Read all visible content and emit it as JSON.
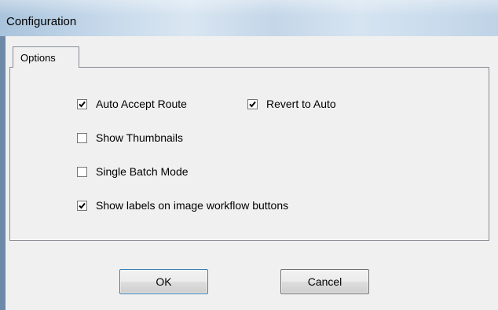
{
  "window": {
    "title": "Configuration"
  },
  "tabs": [
    {
      "label": "Options",
      "selected": true
    }
  ],
  "options": {
    "auto_accept_route": {
      "label": "Auto Accept Route",
      "checked": true
    },
    "revert_to_auto": {
      "label": "Revert to Auto",
      "checked": true
    },
    "show_thumbnails": {
      "label": "Show Thumbnails",
      "checked": false
    },
    "single_batch_mode": {
      "label": "Single Batch Mode",
      "checked": false
    },
    "show_labels": {
      "label": "Show labels on image workflow buttons",
      "checked": true
    }
  },
  "buttons": {
    "ok_label": "OK",
    "cancel_label": "Cancel"
  },
  "colors": {
    "dialog_bg": "#f0f0f0",
    "titlebar": "#c5d8ea",
    "frame": "#6e8aa8",
    "focus_border": "#3c7fb1"
  }
}
